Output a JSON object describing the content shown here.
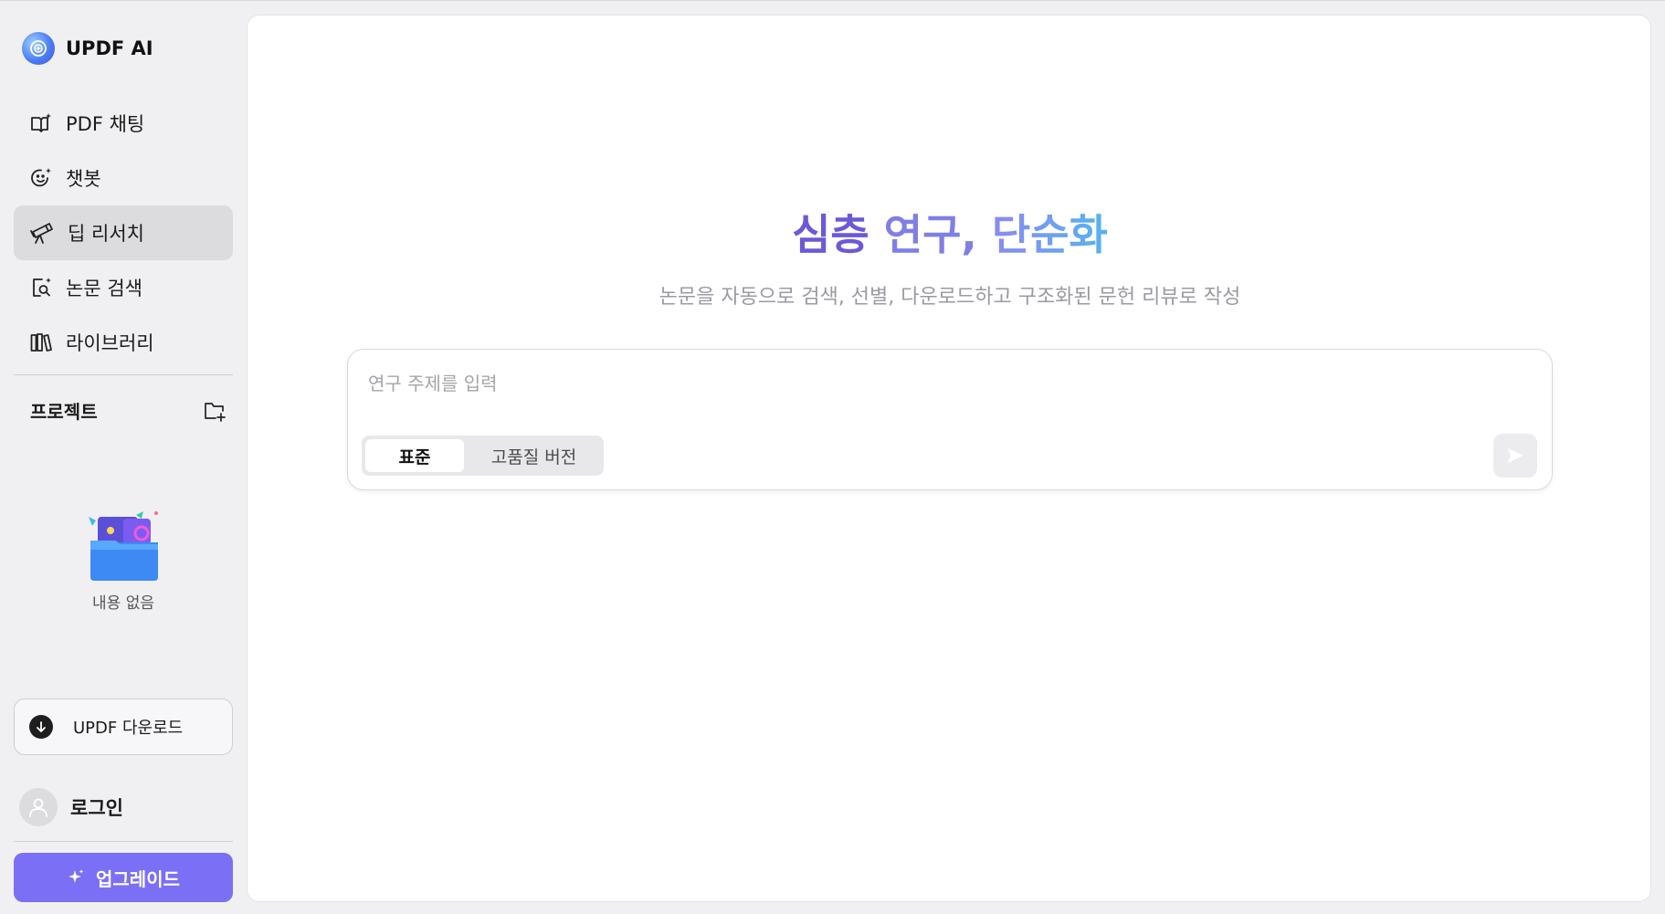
{
  "brand": {
    "name": "UPDF AI"
  },
  "nav": {
    "items": [
      {
        "label": "PDF 채팅",
        "icon": "book-sparkle-icon",
        "active": false
      },
      {
        "label": "챗봇",
        "icon": "smile-sparkle-icon",
        "active": false
      },
      {
        "label": "딥 리서치",
        "icon": "telescope-icon",
        "active": true
      },
      {
        "label": "논문 검색",
        "icon": "document-search-icon",
        "active": false
      },
      {
        "label": "라이브러리",
        "icon": "library-icon",
        "active": false
      }
    ]
  },
  "projects": {
    "title": "프로젝트",
    "new_icon": "folder-plus-icon",
    "empty_text": "내용 없음"
  },
  "download": {
    "label": "UPDF 다운로드"
  },
  "login": {
    "label": "로그인"
  },
  "upgrade": {
    "label": "업그레이드"
  },
  "hero": {
    "title_part1": "심층 ",
    "title_part2": "연구, ",
    "title_part3": "단순화",
    "subtitle": "논문을 자동으로 검색, 선별, 다운로드하고 구조화된 문헌 리뷰로 작성"
  },
  "prompt": {
    "placeholder": "연구 주제를 입력",
    "value": "",
    "modes": [
      {
        "label": "표준",
        "selected": true
      },
      {
        "label": "고품질 버전",
        "selected": false
      }
    ]
  },
  "colors": {
    "accent": "#7b6ff5",
    "active_nav": "#dcdcdf",
    "title_start": "#6a5ad8",
    "title_end": "#56b4ee"
  }
}
